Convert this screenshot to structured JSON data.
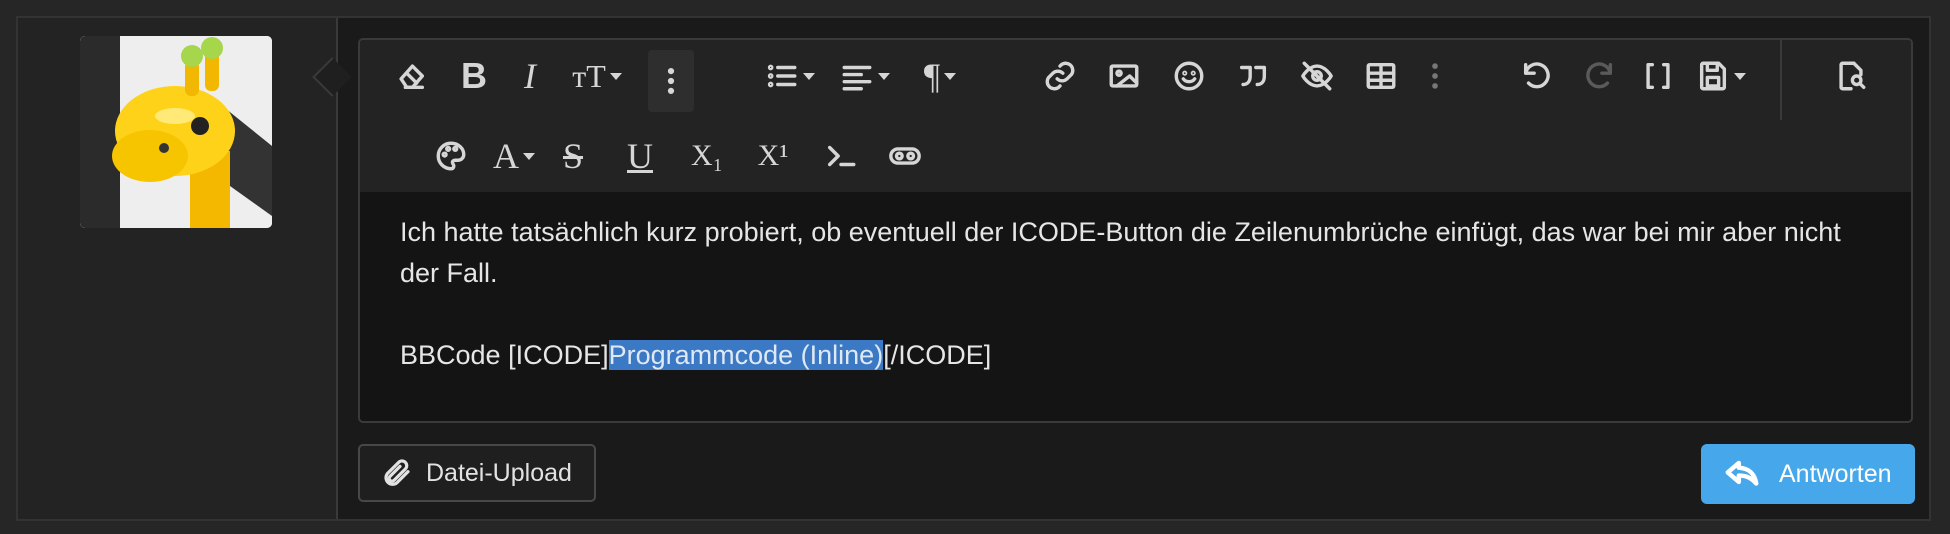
{
  "editor": {
    "paragraph1": "Ich hatte tatsächlich kurz probiert, ob eventuell der ICODE-Button die Zeilenumbrüche einfügt, das war bei mir aber nicht der Fall.",
    "line2_prefix": "BBCode [ICODE]",
    "line2_selected": "Programmcode (Inline)",
    "line2_suffix": "[/ICODE]",
    "selection_color": "#3b79c4"
  },
  "toolbar": {
    "row1": [
      "eraser-icon",
      "bold-icon",
      "italic-icon",
      "text-size-icon",
      "more-vertical-icon",
      "list-icon",
      "align-icon",
      "paragraph-icon",
      "link-icon",
      "image-icon",
      "smiley-icon",
      "quote-icon",
      "spoiler-icon",
      "table-icon",
      "more-vertical-icon",
      "undo-icon",
      "redo-icon",
      "brackets-icon",
      "save-icon",
      "preview-icon"
    ],
    "row2": [
      "palette-icon",
      "font-color-icon",
      "strikethrough-icon",
      "underline-icon",
      "subscript-icon",
      "superscript-icon",
      "code-icon",
      "inline-spoiler-icon"
    ],
    "bold_glyph": "B",
    "italic_glyph": "I",
    "size_glyph": "тT",
    "paragraph_glyph": "¶",
    "font_color_glyph": "A",
    "strike_glyph": "S",
    "underline_glyph": "U",
    "sub_glyph": "X₁",
    "sup_glyph": "X¹"
  },
  "buttons": {
    "upload_label": "Datei-Upload",
    "reply_label": "Antworten",
    "reply_color": "#47a7eb"
  }
}
